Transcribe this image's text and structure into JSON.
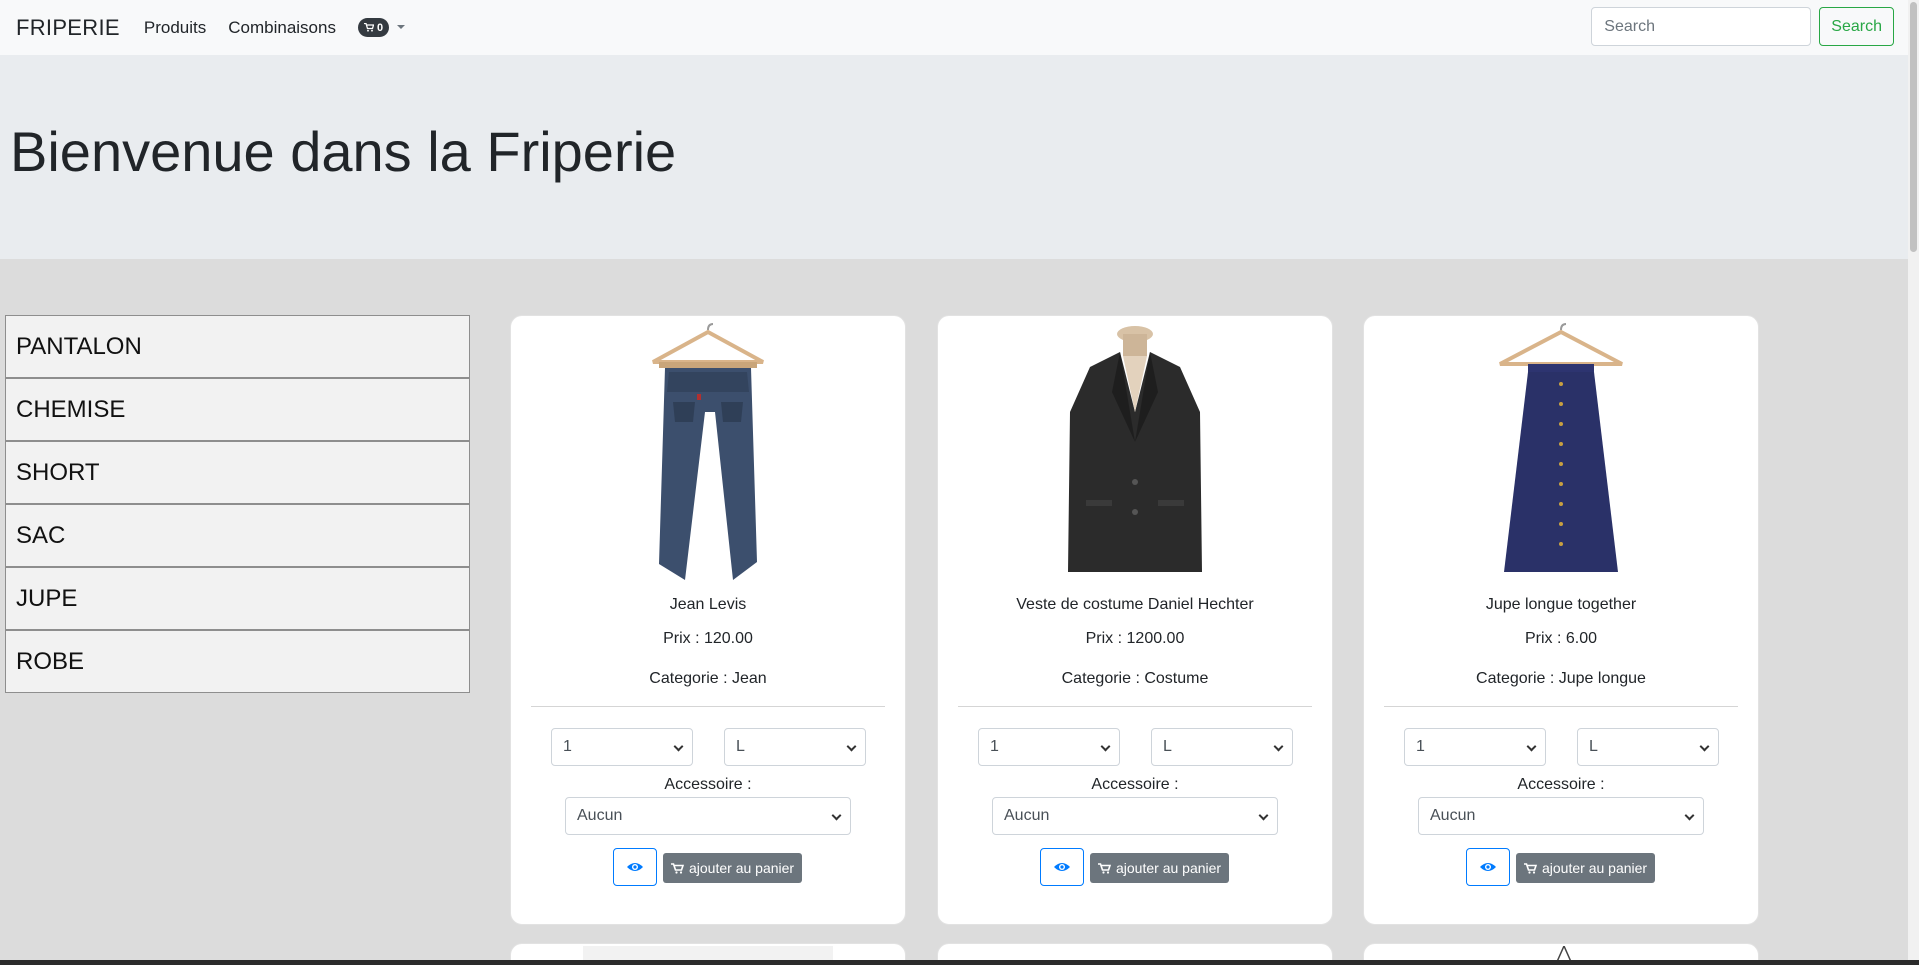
{
  "navbar": {
    "brand": "FRIPERIE",
    "links": [
      "Produits",
      "Combinaisons"
    ],
    "cart_count": "0",
    "search_placeholder": "Search",
    "search_button": "Search"
  },
  "hero": {
    "title": "Bienvenue dans la Friperie"
  },
  "sidebar": {
    "categories": [
      "PANTALON",
      "CHEMISE",
      "SHORT",
      "SAC",
      "JUPE",
      "ROBE"
    ]
  },
  "products": [
    {
      "name": "Jean Levis",
      "price": "Prix : 120.00",
      "category": "Categorie : Jean",
      "qty": "1",
      "size": "L",
      "accessory_label": "Accessoire :",
      "accessory": "Aucun",
      "add_label": "ajouter au panier",
      "image": "jeans"
    },
    {
      "name": "Veste de costume Daniel Hechter",
      "price": "Prix : 1200.00",
      "category": "Categorie : Costume",
      "qty": "1",
      "size": "L",
      "accessory_label": "Accessoire :",
      "accessory": "Aucun",
      "add_label": "ajouter au panier",
      "image": "suit-jacket"
    },
    {
      "name": "Jupe longue together",
      "price": "Prix : 6.00",
      "category": "Categorie : Jupe longue",
      "qty": "1",
      "size": "L",
      "accessory_label": "Accessoire :",
      "accessory": "Aucun",
      "add_label": "ajouter au panier",
      "image": "long-skirt"
    }
  ],
  "colors": {
    "success": "#28a745",
    "primary": "#007bff",
    "secondary": "#6c757d",
    "dark_badge": "#343a40"
  }
}
